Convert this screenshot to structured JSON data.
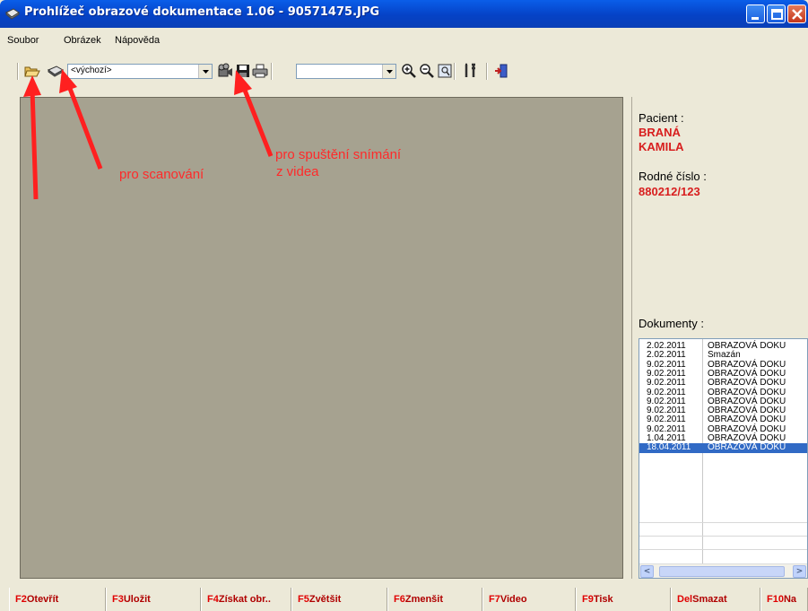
{
  "window": {
    "title": "Prohlížeč obrazové dokumentace 1.06 - 90571475.JPG"
  },
  "menu": {
    "file": "Soubor",
    "image": "Obrázek",
    "help": "Nápověda"
  },
  "toolbar": {
    "source_select": "<výchozí>",
    "zoom_select": "",
    "icons": [
      "open-folder-icon",
      "scanner-icon",
      "video-capture-icon",
      "save-icon",
      "print-icon",
      "zoom-in-icon",
      "zoom-out-icon",
      "fit-icon",
      "settings-icon",
      "exit-icon"
    ]
  },
  "annotations": {
    "scan": "pro scanování",
    "video_line1": "pro spuštění snímání",
    "video_line2": "z videa"
  },
  "patient": {
    "label": "Pacient :",
    "surname": "BRANÁ",
    "firstname": "KAMILA",
    "birth_label": "Rodné číslo :",
    "birth_number": "880212/123"
  },
  "documents": {
    "label": "Dokumenty :",
    "rows": [
      {
        "date": "2.02.2011",
        "title": "OBRAZOVÁ DOKU"
      },
      {
        "date": "2.02.2011",
        "title": "Smazán"
      },
      {
        "date": "9.02.2011",
        "title": "OBRAZOVÁ DOKU"
      },
      {
        "date": "9.02.2011",
        "title": "OBRAZOVÁ DOKU"
      },
      {
        "date": "9.02.2011",
        "title": "OBRAZOVÁ DOKU"
      },
      {
        "date": "9.02.2011",
        "title": "OBRAZOVÁ DOKU"
      },
      {
        "date": "9.02.2011",
        "title": "OBRAZOVÁ DOKU"
      },
      {
        "date": "9.02.2011",
        "title": "OBRAZOVÁ DOKU"
      },
      {
        "date": "9.02.2011",
        "title": "OBRAZOVÁ DOKU"
      },
      {
        "date": "9.02.2011",
        "title": "OBRAZOVÁ DOKU"
      },
      {
        "date": "1.04.2011",
        "title": "OBRAZOVÁ DOKU"
      },
      {
        "date": "18.04.2011",
        "title": "OBRAZOVÁ DOKU"
      }
    ],
    "selected_index": 11
  },
  "function_keys": [
    {
      "key": "F2",
      "label": "Otevřít"
    },
    {
      "key": "F3",
      "label": "Uložit"
    },
    {
      "key": "F4",
      "label": "Získat obr.."
    },
    {
      "key": "F5",
      "label": "Zvětšit"
    },
    {
      "key": "F6",
      "label": "Zmenšit"
    },
    {
      "key": "F7",
      "label": "Video"
    },
    {
      "key": "F9",
      "label": "Tisk"
    },
    {
      "key": "Del",
      "label": "Smazat"
    },
    {
      "key": "F10",
      "label": "Na"
    }
  ],
  "colors": {
    "titlebar": "#0542c6",
    "annotation": "#ff2a2a",
    "patient_value": "#d81e1e",
    "selection": "#316ac5",
    "image_area": "#a6a290"
  }
}
